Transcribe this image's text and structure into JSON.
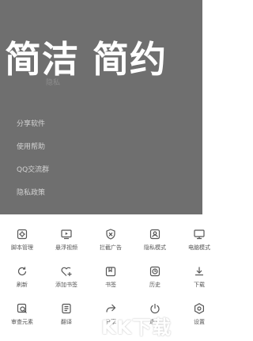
{
  "overlay": {
    "headline": "简洁 简约",
    "partial_item": "隐私",
    "menu_items": [
      "分享软件",
      "使用帮助",
      "QQ交流群",
      "隐私政策"
    ]
  },
  "grid": {
    "items": [
      {
        "label": "脚本管理",
        "icon": "script-icon"
      },
      {
        "label": "悬浮视频",
        "icon": "floating-video-icon"
      },
      {
        "label": "拦截广告",
        "icon": "ad-block-icon"
      },
      {
        "label": "隐私模式",
        "icon": "privacy-icon"
      },
      {
        "label": "电脑模式",
        "icon": "desktop-icon"
      },
      {
        "label": "刷新",
        "icon": "refresh-icon"
      },
      {
        "label": "添加书签",
        "icon": "add-bookmark-icon"
      },
      {
        "label": "书签",
        "icon": "bookmark-icon"
      },
      {
        "label": "历史",
        "icon": "history-icon"
      },
      {
        "label": "下载",
        "icon": "download-icon"
      },
      {
        "label": "审查元素",
        "icon": "inspect-icon"
      },
      {
        "label": "翻译",
        "icon": "translate-icon"
      },
      {
        "label": "分享",
        "icon": "share-icon"
      },
      {
        "label": "退出",
        "icon": "exit-icon"
      },
      {
        "label": "设置",
        "icon": "settings-icon"
      }
    ]
  },
  "watermark": "KK下载"
}
